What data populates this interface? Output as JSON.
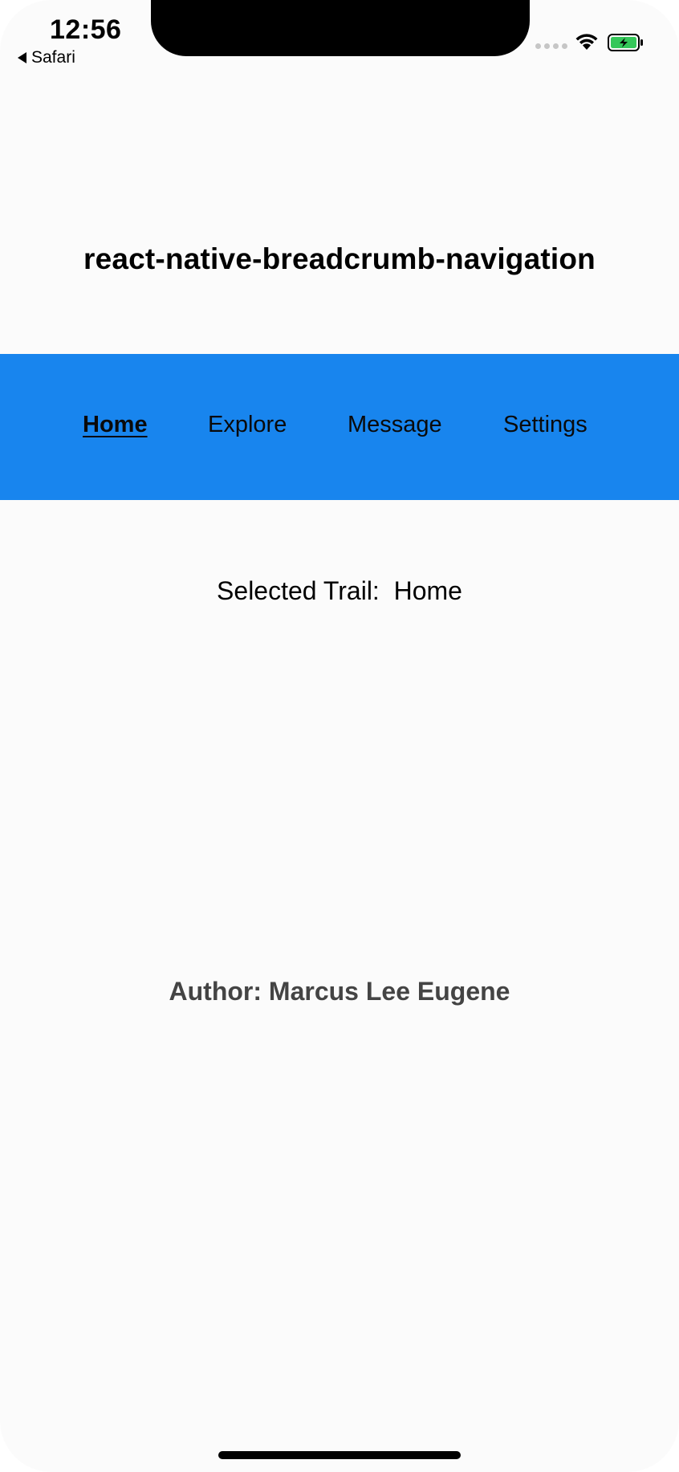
{
  "status_bar": {
    "time": "12:56",
    "back_label": "Safari",
    "battery_color": "#34c759"
  },
  "app": {
    "title": "react-native-breadcrumb-navigation"
  },
  "nav": {
    "background": "#1885ee",
    "items": [
      {
        "label": "Home",
        "active": true
      },
      {
        "label": "Explore",
        "active": false
      },
      {
        "label": "Message",
        "active": false
      },
      {
        "label": "Settings",
        "active": false
      }
    ]
  },
  "content": {
    "selected_trail_label": "Selected Trail:",
    "selected_trail_value": "Home"
  },
  "footer": {
    "author": "Author: Marcus Lee Eugene"
  }
}
